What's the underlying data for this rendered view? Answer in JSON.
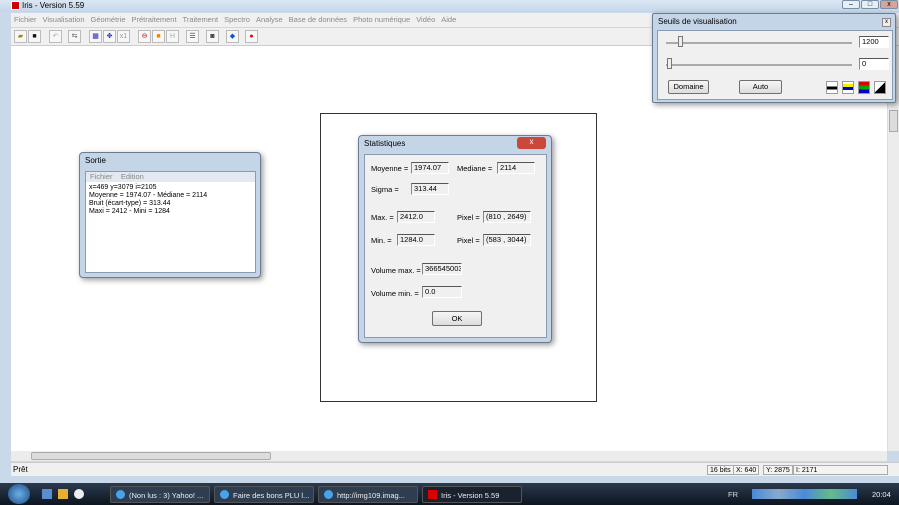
{
  "window": {
    "title": "Iris - Version 5.59"
  },
  "menu": [
    "Fichier",
    "Visualisation",
    "Géométrie",
    "Prétraitement",
    "Traitement",
    "Spectro",
    "Analyse",
    "Base de données",
    "Photo numérique",
    "Vidéo",
    "Aide"
  ],
  "toolbar": [
    "open-icon",
    "save-icon",
    "undo-icon",
    "swap-icon",
    "zoom-grid-icon",
    "move-icon",
    "x1",
    "red-circle-icon",
    "orange-square-icon",
    "H",
    "list-icon",
    "camera-icon",
    "blue-diamond-icon",
    "red-dot-icon"
  ],
  "toolbar_text": {
    "x1": "x1",
    "h": "H"
  },
  "status": {
    "text": "Prêt",
    "bits": "16 bits",
    "x": "X: 640",
    "y": "Y: 2875",
    "i": "I: 2171"
  },
  "sortie": {
    "title": "Sortie",
    "menu": [
      "Fichier",
      "Edition"
    ],
    "lines": [
      "x=469  y=3079  i=2105",
      "Moyenne = 1974.07  -  Médiane = 2114",
      "Bruit (écart-type) = 313.44",
      "Maxi = 2412  -  Mini = 1284"
    ]
  },
  "stats": {
    "title": "Statistiques",
    "moyenne_label": "Moyenne =",
    "moyenne": "1974.07",
    "mediane_label": "Mediane =",
    "mediane": "2114",
    "sigma_label": "Sigma =",
    "sigma": "313.44",
    "max_label": "Max. =",
    "max": "2412.0",
    "pixel_max_label": "Pixel =",
    "pixel_max": "(810 , 2649)",
    "min_label": "Min. =",
    "min": "1284.0",
    "pixel_min_label": "Pixel =",
    "pixel_min": "(583 , 3044)",
    "volmax_label": "Volume max. =",
    "volmax": "3665450035",
    "volmin_label": "Volume min. =",
    "volmin": "0.0",
    "ok": "OK"
  },
  "seuils": {
    "title": "Seuils de visualisation",
    "high": "1200",
    "low": "0",
    "domaine": "Domaine",
    "auto": "Auto"
  },
  "taskbar": {
    "items": [
      "(Non lus : 3) Yahoo! ...",
      "Faire des bons PLU l...",
      "http://img109.imag...",
      "Iris - Version 5.59"
    ],
    "lang": "FR",
    "clock": "20:04"
  }
}
